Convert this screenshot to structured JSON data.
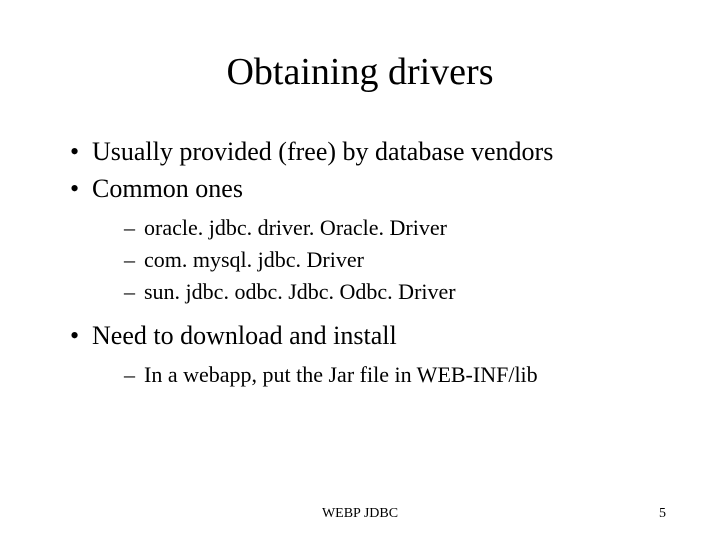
{
  "title": "Obtaining drivers",
  "bullets": [
    {
      "text": "Usually provided (free) by database vendors",
      "sub": []
    },
    {
      "text": "Common ones",
      "sub": [
        "oracle. jdbc. driver. Oracle. Driver",
        "com. mysql. jdbc. Driver",
        "sun. jdbc. odbc. Jdbc. Odbc. Driver"
      ]
    },
    {
      "text": "Need to download and install",
      "sub": [
        "In a webapp, put the Jar file in WEB-INF/lib"
      ]
    }
  ],
  "footer": {
    "center": "WEBP JDBC",
    "page": "5"
  }
}
